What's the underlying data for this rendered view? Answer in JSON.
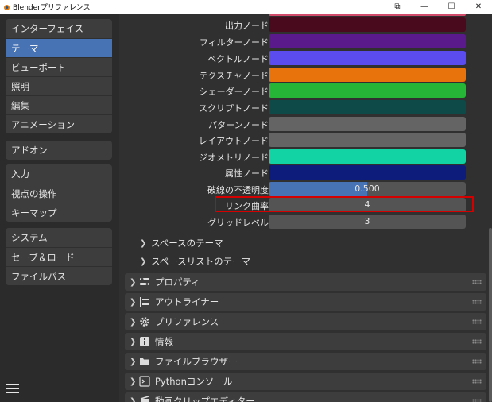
{
  "titlebar": {
    "title": "Blenderプリファレンス",
    "controls": [
      "⧉",
      "—",
      "☐",
      "✕"
    ]
  },
  "sidebar": {
    "group1": [
      {
        "label": "インターフェイス",
        "active": false
      },
      {
        "label": "テーマ",
        "active": true
      },
      {
        "label": "ビューポート",
        "active": false
      },
      {
        "label": "照明",
        "active": false
      },
      {
        "label": "編集",
        "active": false
      },
      {
        "label": "アニメーション",
        "active": false
      }
    ],
    "group2": [
      {
        "label": "アドオン"
      }
    ],
    "group3": [
      {
        "label": "入力"
      },
      {
        "label": "視点の操作"
      },
      {
        "label": "キーマップ"
      }
    ],
    "group4": [
      {
        "label": "システム"
      },
      {
        "label": "セーブ＆ロード"
      },
      {
        "label": "ファイルパス"
      }
    ],
    "menu_icon": "hamburger-icon"
  },
  "theme_rows": [
    {
      "label": "出力ノード",
      "color": "#4a0a1e"
    },
    {
      "label": "フィルターノード",
      "color": "#5a1a8c"
    },
    {
      "label": "ベクトルノード",
      "color": "#5b4cf0"
    },
    {
      "label": "テクスチャノード",
      "color": "#e8720c"
    },
    {
      "label": "シェーダーノード",
      "color": "#26b536"
    },
    {
      "label": "スクリプトノード",
      "color": "#0e4a47"
    },
    {
      "label": "パターンノード",
      "color": "#646464"
    },
    {
      "label": "レイアウトノード",
      "color": "#646464"
    },
    {
      "label": "ジオメトリノード",
      "color": "#12d3a3"
    },
    {
      "label": "属性ノード",
      "color": "#0d1b7a"
    }
  ],
  "values": {
    "wire_opacity": {
      "label": "破線の不透明度",
      "value": "0.500",
      "fraction": 0.5
    },
    "link_curvature": {
      "label": "リンク曲率",
      "value": "4"
    },
    "grid_level": {
      "label": "グリッドレベル",
      "value": "3"
    }
  },
  "subpanels": [
    {
      "label": "スペースのテーマ"
    },
    {
      "label": "スペースリストのテーマ"
    }
  ],
  "panels": [
    {
      "label": "プロパティ",
      "icon": "properties-icon"
    },
    {
      "label": "アウトライナー",
      "icon": "outliner-icon"
    },
    {
      "label": "プリファレンス",
      "icon": "gear-icon"
    },
    {
      "label": "情報",
      "icon": "info-icon"
    },
    {
      "label": "ファイルブラウザー",
      "icon": "folder-icon"
    },
    {
      "label": "Pythonコンソール",
      "icon": "console-icon"
    },
    {
      "label": "動画クリップエディター",
      "icon": "clip-icon"
    }
  ],
  "colors": {
    "accent": "#4772b3",
    "highlight": "#d40000",
    "top_strip": "#d24b6a"
  }
}
